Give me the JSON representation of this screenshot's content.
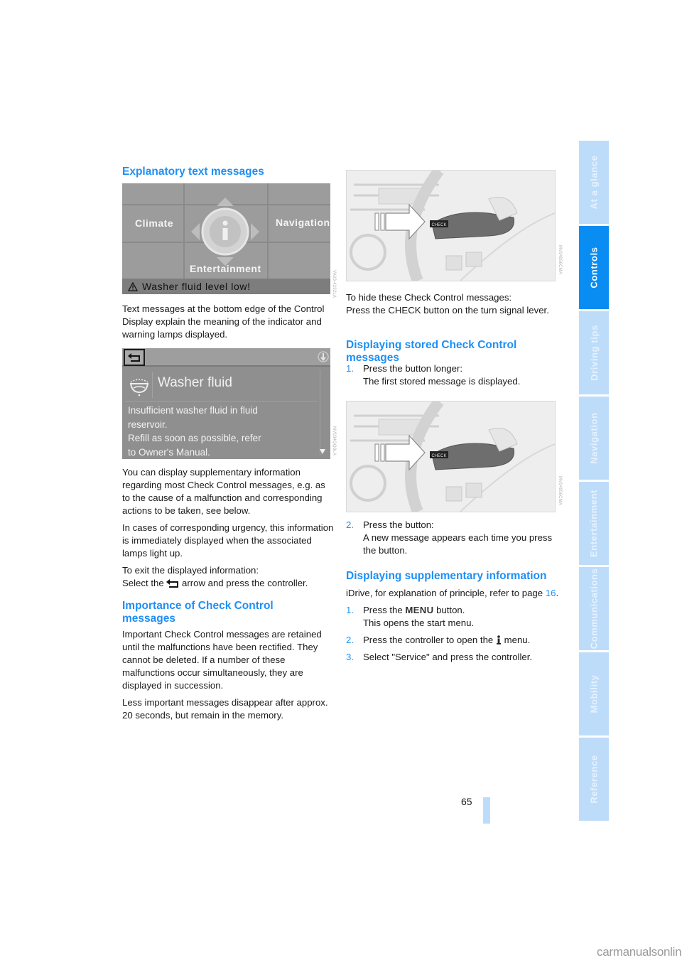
{
  "left_column": {
    "heading_explanatory": "Explanatory text messages",
    "display1": {
      "menu_left": "Climate",
      "menu_right": "Navigation",
      "menu_bottom": "Entertainment",
      "center_icon": "info-icon",
      "status_icon": "warning-triangle-icon",
      "status_text": "Washer fluid level low!",
      "code": "VA03-4232LA"
    },
    "para_text_messages": "Text messages at the bottom edge of the Control Display explain the meaning of the indicator and warning lamps displayed.",
    "display2": {
      "back_icon": "back-arrow-icon",
      "corner_icon": "info-down-icon",
      "title_icon": "washer-fluid-icon",
      "title": "Washer fluid",
      "body_lines": [
        "Insufficient washer fluid in fluid",
        "reservoir.",
        "Refill as soon as possible, refer",
        "to Owner's Manual."
      ],
      "scroll_icon": "scroll-down-icon",
      "code": "MV034QQ8LA"
    },
    "para_supplementary": "You can display supplementary information regarding most Check Control messages, e.g. as to the cause of a malfunction and corresponding actions to be taken, see below.",
    "para_urgency": "In cases of corresponding urgency, this information is immediately displayed when the associated lamps light up.",
    "para_exit_line1": "To exit the displayed information:",
    "para_exit_pre": "Select the",
    "para_exit_post": "arrow and press the controller.",
    "heading_importance": "Importance of Check Control messages",
    "para_important": "Important Check Control messages are retained until the malfunctions have been rectified. They cannot be deleted. If a number of these malfunctions occur simultaneously, they are displayed in succession.",
    "para_less_important": "Less important messages disappear after approx. 20 seconds, but remain in the memory."
  },
  "right_column": {
    "illustration1": {
      "button_label": "CHECK",
      "code": "MV04956CMA"
    },
    "para_hide_line1": "To hide these Check Control messages:",
    "para_hide_line2": "Press the CHECK button on the turn signal lever.",
    "heading_stored": "Displaying stored Check Control messages",
    "stored_steps": [
      {
        "num": "1.",
        "line1": "Press the button longer:",
        "line2": "The first stored message is displayed."
      }
    ],
    "illustration2": {
      "button_label": "CHECK",
      "code": "MV04956CMA"
    },
    "stored_steps_2": [
      {
        "num": "2.",
        "line1": "Press the button:",
        "line2": "A new message appears each time you press the button."
      }
    ],
    "heading_supplementary": "Displaying supplementary information",
    "para_idrive_pre": "iDrive, for explanation of principle, refer to page",
    "para_idrive_link": "16",
    "para_idrive_post": ".",
    "supp_steps": [
      {
        "num": "1.",
        "pre": "Press the",
        "key": "MENU",
        "post": "button.",
        "line2": "This opens the start menu."
      },
      {
        "num": "2.",
        "pre": "Press the controller to open the",
        "icon": "info-i-icon",
        "post": "menu."
      },
      {
        "num": "3.",
        "text": "Select \"Service\" and press the controller."
      }
    ]
  },
  "side_tabs": [
    {
      "label": "At a glance",
      "active": false
    },
    {
      "label": "Controls",
      "active": true
    },
    {
      "label": "Driving tips",
      "active": false
    },
    {
      "label": "Navigation",
      "active": false
    },
    {
      "label": "Entertainment",
      "active": false
    },
    {
      "label": "Communications",
      "active": false
    },
    {
      "label": "Mobility",
      "active": false
    },
    {
      "label": "Reference",
      "active": false
    }
  ],
  "footer": {
    "page_number": "65",
    "site": "carmanualsonline.info"
  },
  "colors": {
    "accent": "#1e8ff5",
    "tab_active": "#0a8df2",
    "tab_inactive": "#bddcfa"
  }
}
